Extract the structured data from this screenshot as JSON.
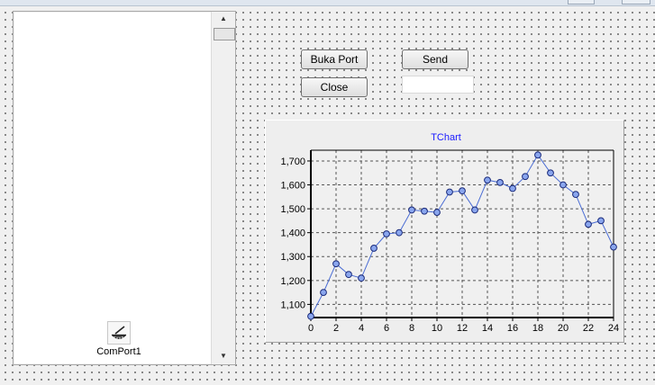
{
  "form": {
    "buttons": {
      "open_port": "Buka Port",
      "send": "Send",
      "close": "Close"
    },
    "send_input": {
      "value": ""
    },
    "component": {
      "label": "ComPort1",
      "icon": "comport-icon"
    }
  },
  "listbox": {
    "items": []
  },
  "chart_data": {
    "type": "line",
    "title": "TChart",
    "x": [
      0,
      1,
      2,
      3,
      4,
      5,
      6,
      7,
      8,
      9,
      10,
      11,
      12,
      13,
      14,
      15,
      16,
      17,
      18,
      19,
      20,
      21,
      22,
      23,
      24
    ],
    "series": [
      {
        "values": [
          1050,
          1150,
          1270,
          1225,
          1210,
          1335,
          1395,
          1400,
          1495,
          1490,
          1485,
          1570,
          1575,
          1495,
          1620,
          1610,
          1585,
          1635,
          1725,
          1650,
          1600,
          1560,
          1435,
          1450,
          1340
        ]
      }
    ],
    "x_ticks": [
      "0",
      "2",
      "4",
      "6",
      "8",
      "10",
      "12",
      "14",
      "16",
      "18",
      "20",
      "22",
      "24"
    ],
    "y_ticks": [
      "1,100",
      "1,200",
      "1,300",
      "1,400",
      "1,500",
      "1,600",
      "1,700"
    ],
    "xlim": [
      0,
      24
    ],
    "ylim": [
      1045,
      1745
    ],
    "grid": true,
    "colors": {
      "line": "#4a6cd4",
      "marker": "#8aa6ee",
      "title": "#1a1aff"
    }
  }
}
